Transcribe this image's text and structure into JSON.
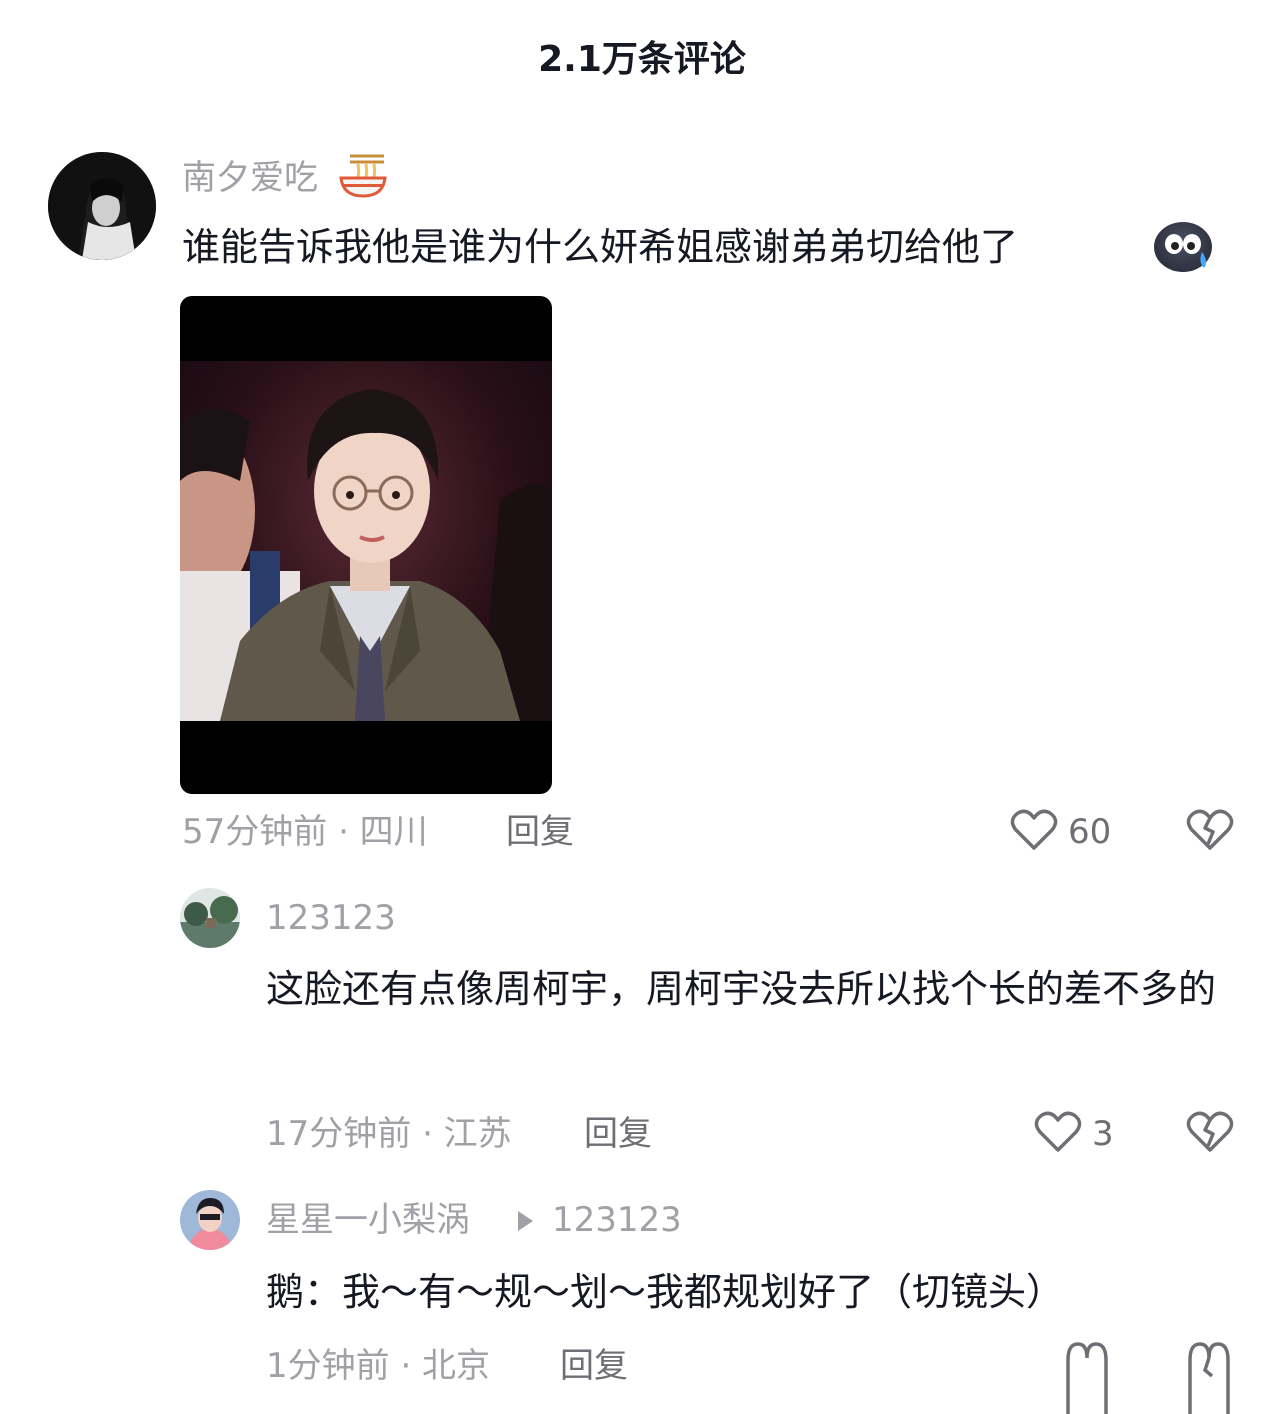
{
  "header": {
    "title": "2.1万条评论"
  },
  "comments": [
    {
      "username": "南夕爱吃",
      "text": "谁能告诉我他是谁为什么妍希姐感谢弟弟切给他了",
      "time_location": "57分钟前 · 四川",
      "reply_label": "回复",
      "likes": "60",
      "replies": [
        {
          "username": "123123",
          "text": "这脸还有点像周柯宇，周柯宇没去所以找个长的差不多的",
          "time_location": "17分钟前 · 江苏",
          "reply_label": "回复",
          "likes": "3"
        },
        {
          "username": "星星一小梨涡",
          "reply_to": "123123",
          "text": "鹅：我～有～规～划～我都规划好了（切镜头）",
          "time_location": "1分钟前 · 北京",
          "reply_label": "回复"
        }
      ]
    }
  ],
  "icons": {
    "noodle_emoji": "noodle-bowl-icon",
    "cry_emoji": "crying-face-emoji-icon",
    "like": "heart-outline-icon",
    "dislike": "broken-heart-icon",
    "reply_arrow": "triangle-right-icon"
  },
  "colors": {
    "text": "#161823",
    "secondary": "#a0a1a6",
    "action": "#6e6f75"
  }
}
